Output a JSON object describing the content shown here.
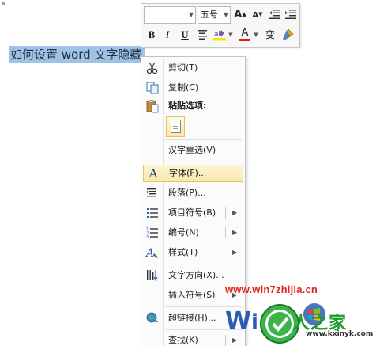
{
  "document": {
    "selected_text": "如何设置 word 文字隐藏"
  },
  "mini_toolbar": {
    "font_name": "",
    "font_size": "五号",
    "grow_font": "A",
    "shrink_font": "A",
    "bold": "B",
    "italic": "I",
    "underline": "U",
    "font_color_letter": "A",
    "phonetic_guide": "变"
  },
  "context_menu": {
    "items": [
      {
        "label": "剪切(T)",
        "icon": "scissors-icon"
      },
      {
        "label": "复制(C)",
        "icon": "copy-icon"
      },
      {
        "label": "粘贴选项:",
        "icon": "clipboard-icon"
      },
      {
        "label": "汉字重选(V)",
        "icon": ""
      },
      {
        "label": "字体(F)...",
        "icon": "font-icon"
      },
      {
        "label": "段落(P)...",
        "icon": "paragraph-icon"
      },
      {
        "label": "项目符号(B)",
        "icon": "bullets-icon"
      },
      {
        "label": "编号(N)",
        "icon": "numbering-icon"
      },
      {
        "label": "样式(T)",
        "icon": "styles-icon"
      },
      {
        "label": "文字方向(X)...",
        "icon": "text-direction-icon"
      },
      {
        "label": "插入符号(S)",
        "icon": ""
      },
      {
        "label": "超链接(H)...",
        "icon": "hyperlink-icon"
      },
      {
        "label": "查找(K)",
        "icon": ""
      }
    ],
    "highlighted_index": 4
  },
  "watermark": {
    "url": "www.win7zhijia.cn",
    "brand": "系统之家",
    "brand_visible": "人之家",
    "site": "www.kxinyk.com",
    "colors": {
      "url": "#e0261b",
      "brand": "#1d9a2c",
      "logo_green": "#3bb54a"
    }
  },
  "colors": {
    "selection": "#9fc3e7",
    "menu_highlight": "#f9e8a9",
    "font_color_bar": "#e02020",
    "highlight_bar": "#f5e500"
  }
}
